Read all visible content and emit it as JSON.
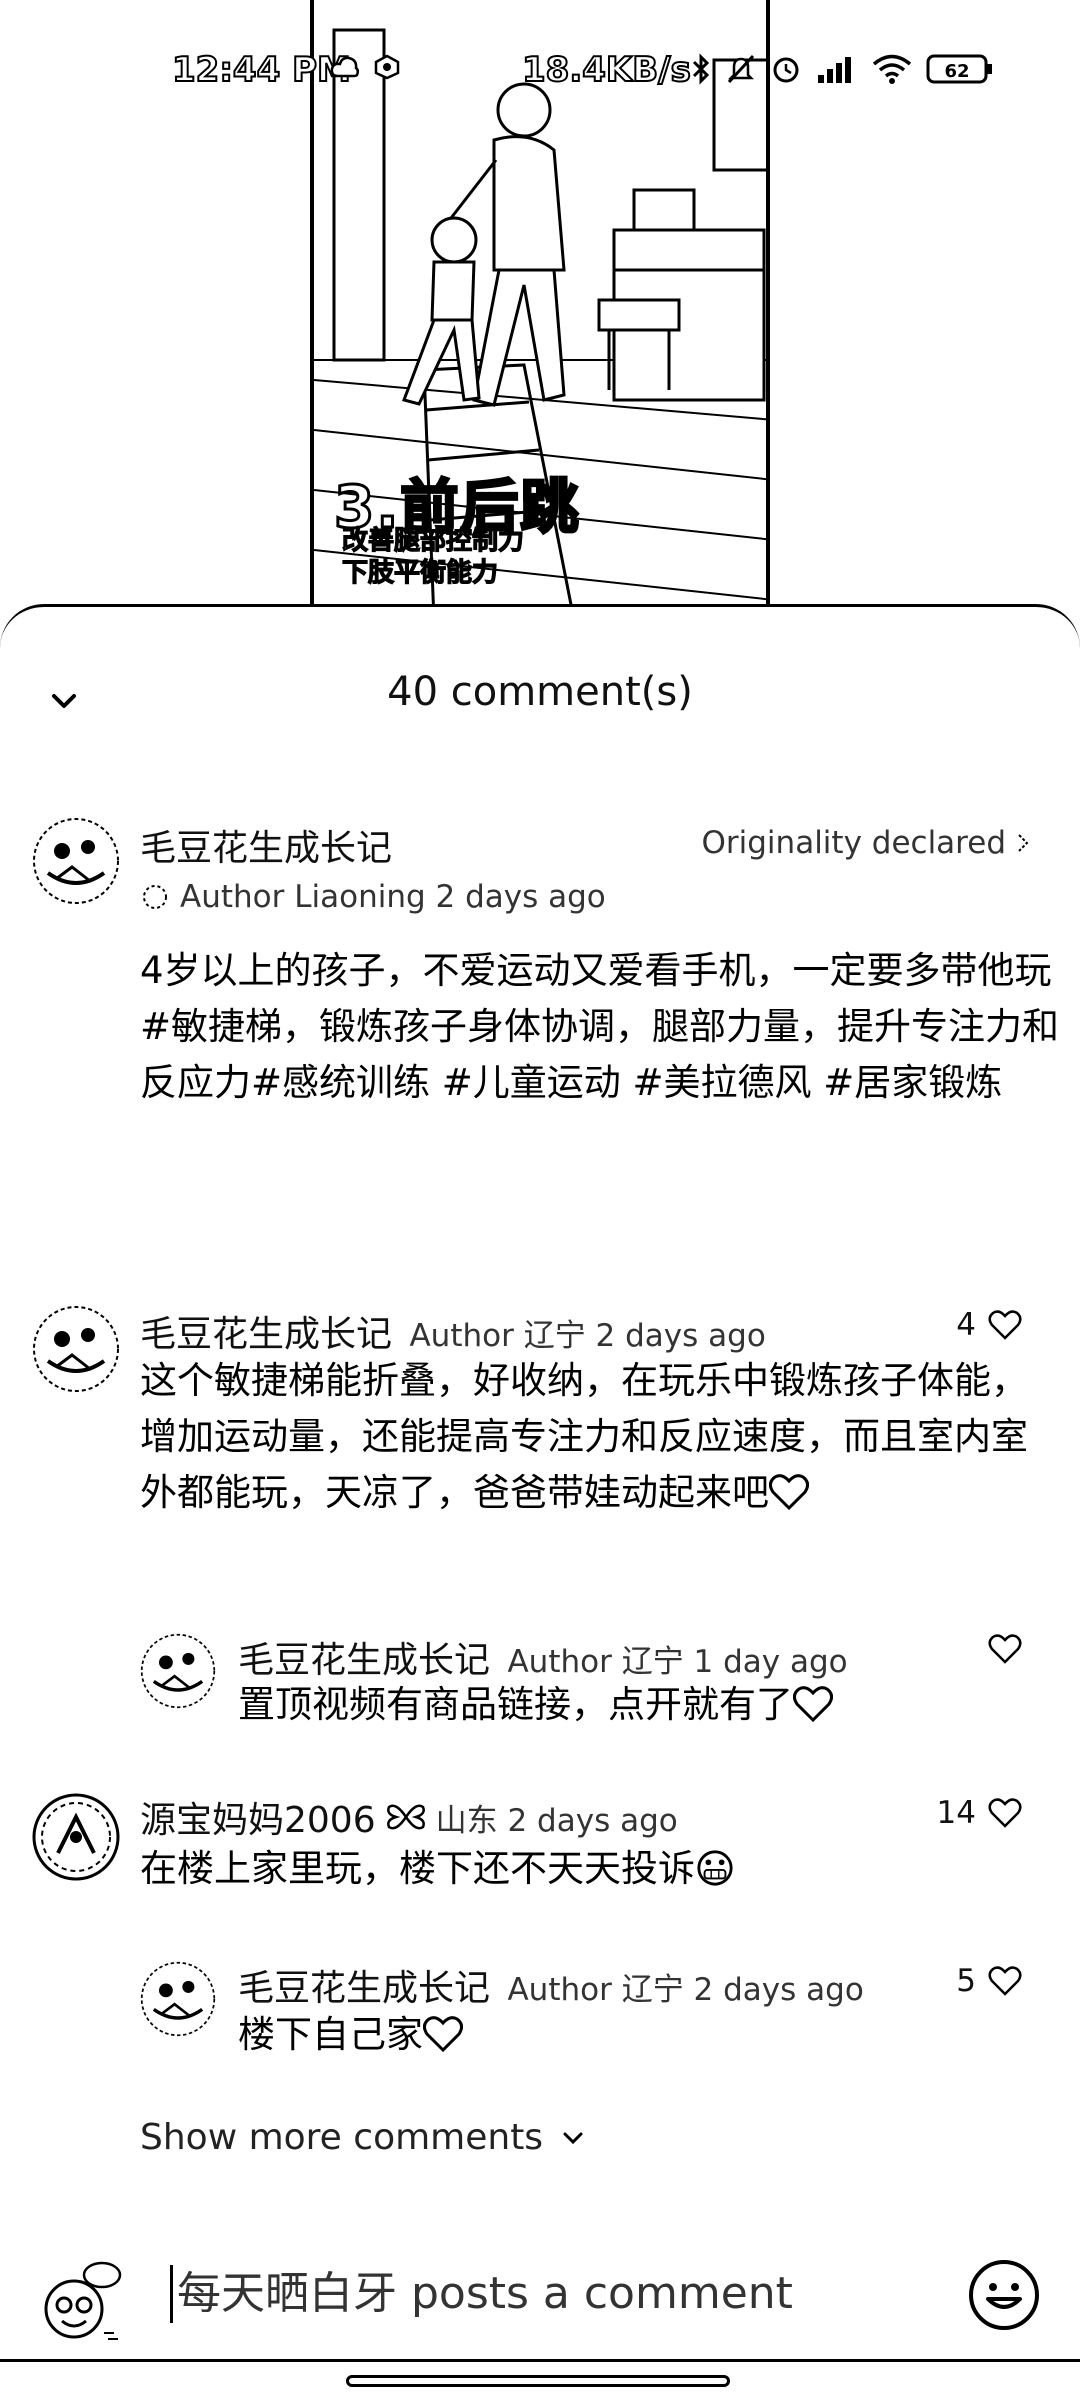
{
  "status_bar": {
    "time": "12:44 PM",
    "network_speed": "18.4KB/s",
    "battery": "62"
  },
  "video": {
    "caption_title": "3.前后跳",
    "caption_line1": "改善腿部控制力",
    "caption_line2": "下肢平衡能力"
  },
  "sheet": {
    "title": "40 comment(s)",
    "collapse_icon": "chevron-down-icon"
  },
  "post": {
    "author": "毛豆花生成长记",
    "originality": "Originality declared",
    "meta": "Author Liaoning 2 days ago",
    "body": "4岁以上的孩子，不爱运动又爱看手机，一定要多带他玩#敏捷梯，锻炼孩子身体协调，腿部力量，提升专注力和反应力#感统训练 #儿童运动 #美拉德风 #居家锻炼"
  },
  "comments": [
    {
      "name": "毛豆花生成长记",
      "meta": "Author 辽宁 2 days ago",
      "likes": "4",
      "body": "这个敏捷梯能折叠，好收纳，在玩乐中锻炼孩子体能，增加运动量，还能提高专注力和反应速度，而且室内室外都能玩，天凉了，爸爸带娃动起来吧",
      "reply": {
        "name": "毛豆花生成长记",
        "meta": "Author 辽宁 1 day ago",
        "likes": "",
        "body": "置顶视频有商品链接，点开就有了"
      }
    },
    {
      "name": "源宝妈妈2006",
      "meta": "山东 2 days ago",
      "likes": "14",
      "body": "在楼上家里玩，楼下还不天天投诉",
      "reply": {
        "name": "毛豆花生成长记",
        "meta": "Author 辽宁 2 days ago",
        "likes": "5",
        "body": "楼下自己家"
      }
    }
  ],
  "show_more": "Show more comments",
  "input": {
    "placeholder": "每天晒白牙 posts a comment"
  },
  "colors": {
    "background": "#ffffff",
    "text": "#000000",
    "secondary_text": "#333333"
  }
}
